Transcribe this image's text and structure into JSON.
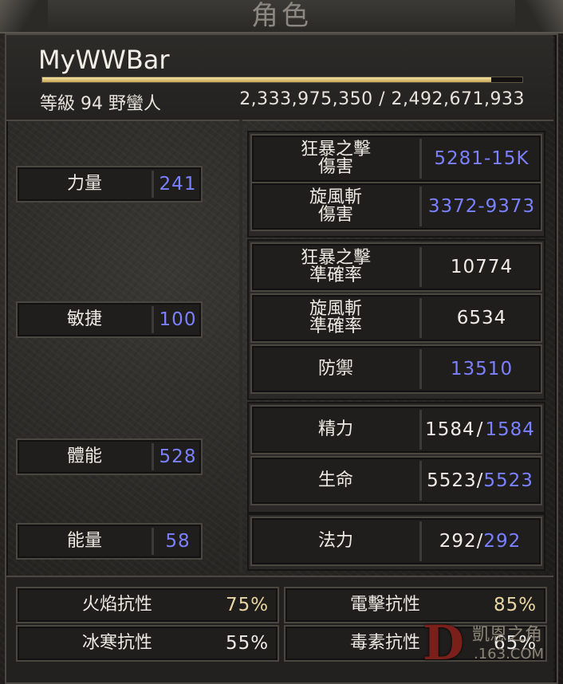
{
  "window": {
    "title": "角色"
  },
  "character": {
    "name": "MyWWBar",
    "level_line": "等級 94 野蠻人",
    "experience": "2,333,975,350 / 2,492,671,933",
    "xp_progress_fraction": 0.936
  },
  "attributes": [
    {
      "label": "力量",
      "value": "241"
    },
    {
      "label": "敏捷",
      "value": "100"
    },
    {
      "label": "體能",
      "value": "528"
    },
    {
      "label": "能量",
      "value": "58"
    }
  ],
  "combat": {
    "frenzy_damage": {
      "label_line1": "狂暴之擊",
      "label_line2": "傷害",
      "value": "5281-15K"
    },
    "whirlwind_damage": {
      "label_line1": "旋風斬",
      "label_line2": "傷害",
      "value": "3372-9373"
    },
    "frenzy_ar": {
      "label_line1": "狂暴之擊",
      "label_line2": "準確率",
      "value": "10774"
    },
    "whirlwind_ar": {
      "label_line1": "旋風斬",
      "label_line2": "準確率",
      "value": "6534"
    },
    "defense": {
      "label": "防禦",
      "value": "13510"
    }
  },
  "vitals": {
    "stamina": {
      "label": "精力",
      "current": "1584",
      "slash": "/",
      "max": "1584"
    },
    "life": {
      "label": "生命",
      "current": "5523",
      "slash": "/",
      "max": "5523"
    },
    "mana": {
      "label": "法力",
      "current": "292",
      "slash": "/",
      "max": "292"
    }
  },
  "resistances": {
    "fire": {
      "label": "火焰抗性",
      "value": "75%"
    },
    "lightning": {
      "label": "電擊抗性",
      "value": "85%"
    },
    "cold": {
      "label": "冰寒抗性",
      "value": "55%"
    },
    "poison": {
      "label": "毒素抗性",
      "value": "65%"
    }
  },
  "watermark": {
    "line1": "凱恩之角",
    "line2": ".163.COM",
    "logo_letter": "D"
  },
  "colors": {
    "boosted_blue": "#7a80ff",
    "gold_value": "#e9d6a4",
    "xp_bar": "#c9a655"
  }
}
